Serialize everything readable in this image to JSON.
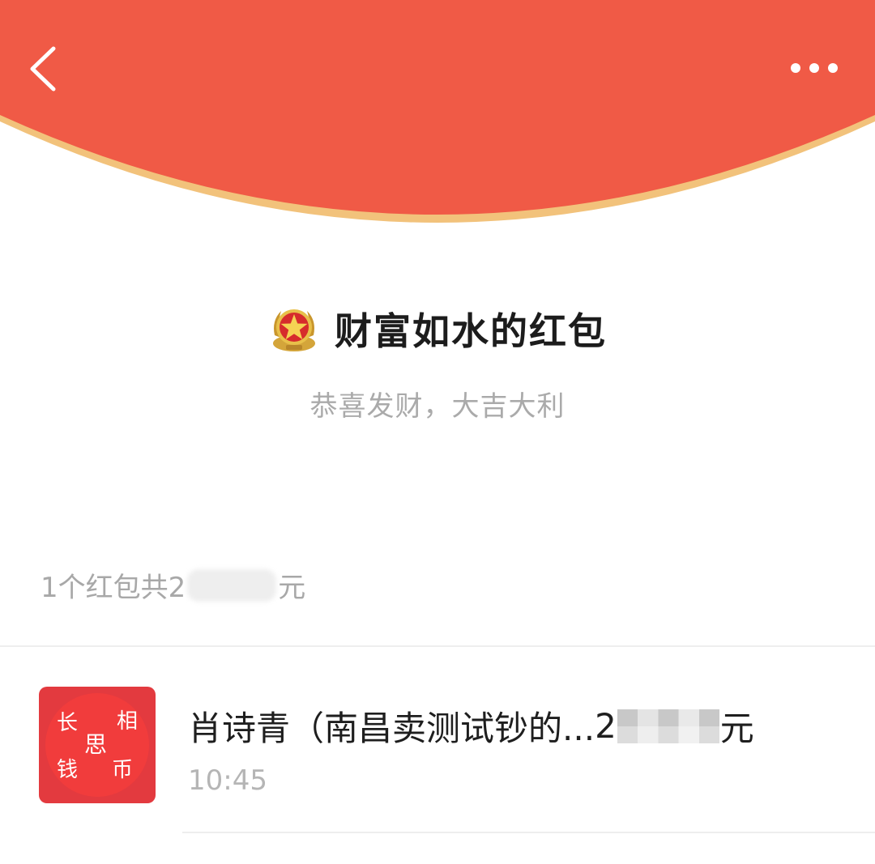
{
  "theme": {
    "accent": "#F05A46",
    "rim": "#F2C27B",
    "title_color": "#1C1C1C",
    "muted_color": "#AAAAAA"
  },
  "header": {
    "back_icon": "chevron-left-icon",
    "more_icon": "more-dots-icon"
  },
  "packet": {
    "sender_emblem": "military-emblem-icon",
    "title": "财富如水的红包",
    "blessing": "恭喜发财，大吉大利"
  },
  "summary": {
    "prefix": "1个红包共2",
    "suffix": "元"
  },
  "receivers": [
    {
      "avatar_chars": [
        "长",
        "相",
        "思",
        "钱",
        "币"
      ],
      "name": "肖诗青（南昌卖测试钞的...",
      "amount_prefix": "2",
      "amount_suffix": "元",
      "time": "10:45"
    }
  ]
}
